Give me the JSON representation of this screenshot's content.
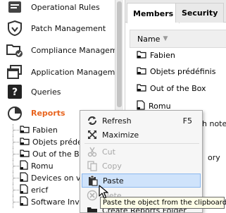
{
  "nav": {
    "items": [
      {
        "label": "Operational Rules",
        "icon": "operational-rules-icon"
      },
      {
        "label": "Patch Management",
        "icon": "patch-management-icon"
      },
      {
        "label": "Compliance Managemen",
        "icon": "compliance-management-icon"
      },
      {
        "label": "Application Managemen",
        "icon": "application-management-icon"
      },
      {
        "label": "Queries",
        "icon": "queries-icon"
      },
      {
        "label": "Reports",
        "icon": "reports-icon",
        "active": true
      }
    ],
    "tree": [
      {
        "label": "Fabien"
      },
      {
        "label": "Objets prédéfi"
      },
      {
        "label": "Out of the Bo"
      },
      {
        "label": "Romu"
      },
      {
        "label": "Devices on v"
      },
      {
        "label": "ericf"
      },
      {
        "label": "Software Inv"
      }
    ]
  },
  "right": {
    "tabs": [
      {
        "label": "Members",
        "active": true
      },
      {
        "label": "Security"
      }
    ],
    "column_header": "Name",
    "rows": [
      {
        "label": "Fabien"
      },
      {
        "label": "Objets prédéfinis"
      },
      {
        "label": "Out of the Box"
      },
      {
        "label": "Romu"
      }
    ],
    "clipped": {
      "t1": "h note",
      "t2": "ory"
    }
  },
  "menu": {
    "items": [
      {
        "label": "Refresh",
        "shortcut": "F5",
        "icon": "refresh-icon",
        "disabled": false
      },
      {
        "label": "Maximize",
        "icon": "maximize-icon",
        "disabled": false
      },
      {
        "label": "Cut",
        "icon": "cut-icon",
        "disabled": true
      },
      {
        "label": "Copy",
        "icon": "copy-icon",
        "disabled": true
      },
      {
        "label": "Paste",
        "icon": "paste-icon",
        "disabled": false,
        "hover": true
      },
      {
        "label": "elete",
        "icon": "delete-icon",
        "disabled": true
      },
      {
        "label": "Create Reports Folder",
        "icon": "create-folder-icon",
        "disabled": false
      }
    ]
  },
  "tooltip": {
    "text": "Paste the object from the clipboard"
  },
  "colors": {
    "active_nav": "#e8641e",
    "menu_hover": "#cfe3fb",
    "tooltip_bg": "#ffffe8"
  }
}
